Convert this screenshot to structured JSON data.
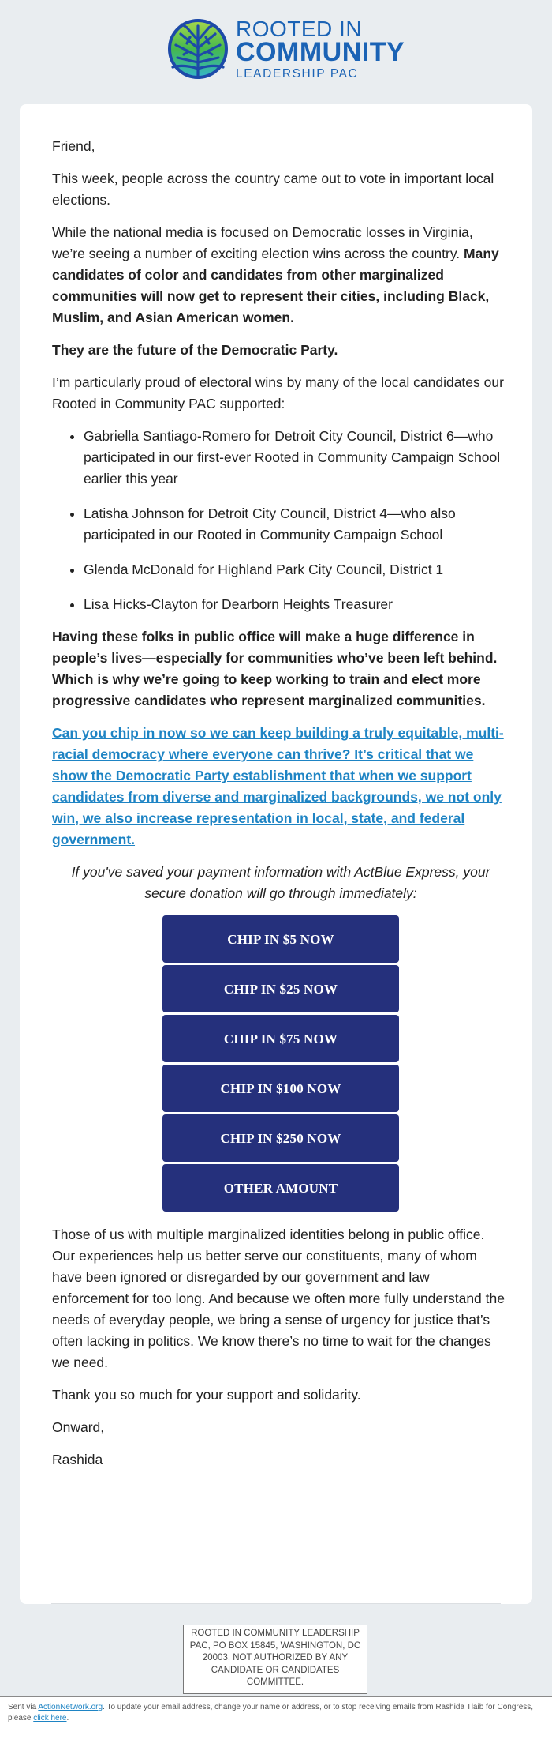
{
  "header": {
    "logo_icon": "tree-in-circle-icon",
    "logo_line1": "ROOTED IN",
    "logo_line2": "COMMUNITY",
    "logo_line3": "LEADERSHIP PAC",
    "brand_color": "#1b63b5"
  },
  "email": {
    "greeting": "Friend,",
    "p1": "This week, people across the country came out to vote in important local elections.",
    "p2_regular": "While the national media is focused on Democratic losses in Virginia, we’re seeing a number of exciting election wins across the country. ",
    "p2_bold": "Many candidates of color and candidates from other marginalized communities will now get to represent their cities, including Black, Muslim, and Asian American women.",
    "p3_bold": "They are the future of the Democratic Party.",
    "p4": "I’m particularly proud of electoral wins by many of the local candidates our Rooted in Community PAC supported:",
    "candidates": [
      "Gabriella Santiago-Romero for Detroit City Council, District 6—who participated in our first-ever Rooted in Community Campaign School earlier this year",
      "Latisha Johnson for Detroit City Council, District 4—who also participated in our Rooted in Community Campaign School",
      "Glenda McDonald for Highland Park City Council, District 1",
      "Lisa Hicks-Clayton for Dearborn Heights Treasurer"
    ],
    "p5_bold": "Having these folks in public office will make a huge difference in people’s lives—especially for communities who’ve been left behind. Which is why we’re going to keep working to train and elect more progressive candidates who represent marginalized communities.",
    "cta_link": "Can you chip in now so we can keep building a truly equitable, multi-racial democracy where everyone can thrive? It’s critical that we show the Democratic Party establishment that when we support candidates from diverse and marginalized backgrounds, we not only win, we also increase representation in local, state, and federal government.",
    "actblue_note": "If you've saved your payment information with ActBlue Express, your secure donation will go through immediately:",
    "buttons": [
      "CHIP IN $5 NOW",
      "CHIP IN $25 NOW",
      "CHIP IN $75 NOW",
      "CHIP IN $100 NOW",
      "CHIP IN $250 NOW",
      "OTHER AMOUNT"
    ],
    "button_color": "#25307c",
    "link_color": "#1e84c4",
    "p6": "Those of us with multiple marginalized identities belong in public office. Our experiences help us better serve our constituents, many of whom have been ignored or disregarded by our government and law enforcement for too long. And because we often more fully understand the needs of everyday people, we bring a sense of urgency for justice that’s often lacking in politics. We know there’s no time to wait for the changes we need.",
    "p7": "Thank you so much for your support and solidarity.",
    "signoff": "Onward,",
    "signature": "Rashida"
  },
  "disclaimer": "ROOTED IN COMMUNITY LEADERSHIP PAC, PO BOX 15845, WASHINGTON, DC 20003, NOT AUTHORIZED BY ANY CANDIDATE OR CANDIDATES COMMITTEE.",
  "footer": {
    "sent_via": "Sent via ",
    "actionnetwork_link": "ActionNetwork.org",
    "middle": ". To update your email address, change your name or address, or to stop receiving emails from Rashida Tlaib for Congress, please ",
    "click_here_link": "click here",
    "end": "."
  }
}
